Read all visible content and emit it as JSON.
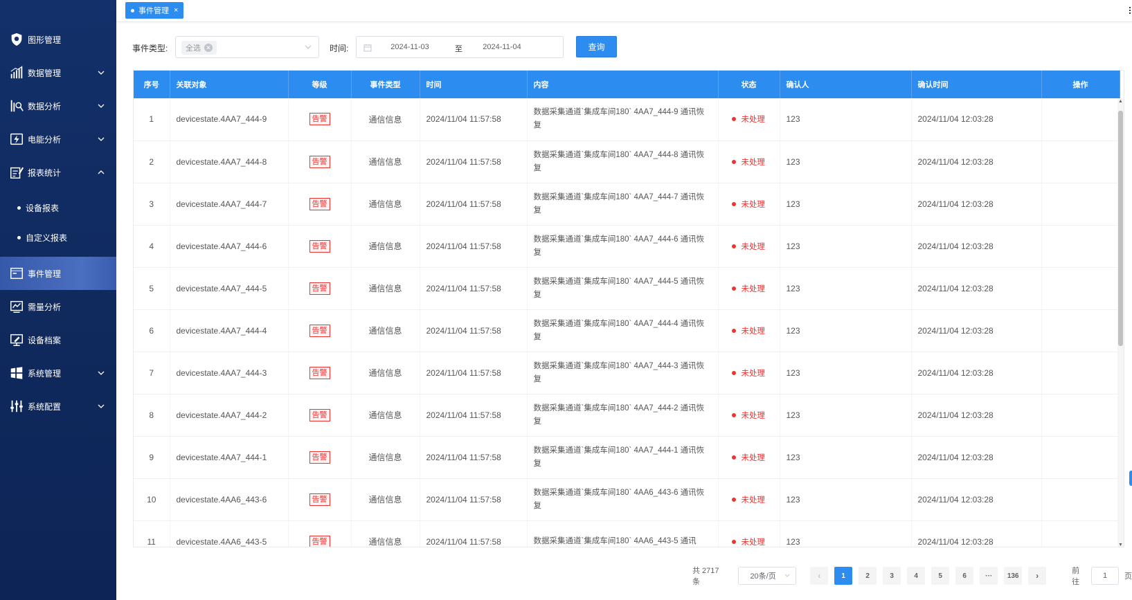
{
  "sidebar": {
    "items": [
      {
        "label": "图形管理",
        "icon": "shield-icon",
        "chevron": ""
      },
      {
        "label": "数据管理",
        "icon": "bar-chart-icon",
        "chevron": "down"
      },
      {
        "label": "数据分析",
        "icon": "analysis-icon",
        "chevron": "down"
      },
      {
        "label": "电能分析",
        "icon": "energy-icon",
        "chevron": "down"
      },
      {
        "label": "报表统计",
        "icon": "report-icon",
        "chevron": "up"
      }
    ],
    "subitems": [
      {
        "label": "设备报表"
      },
      {
        "label": "自定义报表"
      }
    ],
    "items2": [
      {
        "label": "事件管理",
        "icon": "event-icon",
        "chevron": "",
        "active": true
      },
      {
        "label": "需量分析",
        "icon": "demand-chart-icon",
        "chevron": ""
      },
      {
        "label": "设备档案",
        "icon": "device-file-icon",
        "chevron": ""
      },
      {
        "label": "系统管理",
        "icon": "windows-icon",
        "chevron": "down"
      },
      {
        "label": "系统配置",
        "icon": "sliders-icon",
        "chevron": "down"
      }
    ]
  },
  "tabs": [
    {
      "label": "事件管理",
      "close": "×"
    }
  ],
  "filters": {
    "event_type_label": "事件类型:",
    "event_type_value": "全选",
    "time_label": "时间:",
    "date_start": "2024-11-03",
    "date_sep": "至",
    "date_end": "2024-11-04",
    "query_button": "查询"
  },
  "table": {
    "headers": [
      "序号",
      "关联对象",
      "等级",
      "事件类型",
      "时间",
      "内容",
      "状态",
      "确认人",
      "确认时间",
      "操作"
    ],
    "rows": [
      {
        "no": "1",
        "object": "devicestate.4AA7_444-9",
        "level": "告警",
        "type": "通信信息",
        "time": "2024/11/04 11:57:58",
        "content": "数据采集通道`集成车间180` 4AA7_444-9 通讯恢复",
        "status": "未处理",
        "confirmer": "123",
        "confirm_time": "2024/11/04 12:03:28"
      },
      {
        "no": "2",
        "object": "devicestate.4AA7_444-8",
        "level": "告警",
        "type": "通信信息",
        "time": "2024/11/04 11:57:58",
        "content": "数据采集通道`集成车间180` 4AA7_444-8 通讯恢复",
        "status": "未处理",
        "confirmer": "123",
        "confirm_time": "2024/11/04 12:03:28"
      },
      {
        "no": "3",
        "object": "devicestate.4AA7_444-7",
        "level": "告警",
        "type": "通信信息",
        "time": "2024/11/04 11:57:58",
        "content": "数据采集通道`集成车间180` 4AA7_444-7 通讯恢复",
        "status": "未处理",
        "confirmer": "123",
        "confirm_time": "2024/11/04 12:03:28"
      },
      {
        "no": "4",
        "object": "devicestate.4AA7_444-6",
        "level": "告警",
        "type": "通信信息",
        "time": "2024/11/04 11:57:58",
        "content": "数据采集通道`集成车间180` 4AA7_444-6 通讯恢复",
        "status": "未处理",
        "confirmer": "123",
        "confirm_time": "2024/11/04 12:03:28"
      },
      {
        "no": "5",
        "object": "devicestate.4AA7_444-5",
        "level": "告警",
        "type": "通信信息",
        "time": "2024/11/04 11:57:58",
        "content": "数据采集通道`集成车间180` 4AA7_444-5 通讯恢复",
        "status": "未处理",
        "confirmer": "123",
        "confirm_time": "2024/11/04 12:03:28"
      },
      {
        "no": "6",
        "object": "devicestate.4AA7_444-4",
        "level": "告警",
        "type": "通信信息",
        "time": "2024/11/04 11:57:58",
        "content": "数据采集通道`集成车间180` 4AA7_444-4 通讯恢复",
        "status": "未处理",
        "confirmer": "123",
        "confirm_time": "2024/11/04 12:03:28"
      },
      {
        "no": "7",
        "object": "devicestate.4AA7_444-3",
        "level": "告警",
        "type": "通信信息",
        "time": "2024/11/04 11:57:58",
        "content": "数据采集通道`集成车间180` 4AA7_444-3 通讯恢复",
        "status": "未处理",
        "confirmer": "123",
        "confirm_time": "2024/11/04 12:03:28"
      },
      {
        "no": "8",
        "object": "devicestate.4AA7_444-2",
        "level": "告警",
        "type": "通信信息",
        "time": "2024/11/04 11:57:58",
        "content": "数据采集通道`集成车间180` 4AA7_444-2 通讯恢复",
        "status": "未处理",
        "confirmer": "123",
        "confirm_time": "2024/11/04 12:03:28"
      },
      {
        "no": "9",
        "object": "devicestate.4AA7_444-1",
        "level": "告警",
        "type": "通信信息",
        "time": "2024/11/04 11:57:58",
        "content": "数据采集通道`集成车间180` 4AA7_444-1 通讯恢复",
        "status": "未处理",
        "confirmer": "123",
        "confirm_time": "2024/11/04 12:03:28"
      },
      {
        "no": "10",
        "object": "devicestate.4AA6_443-6",
        "level": "告警",
        "type": "通信信息",
        "time": "2024/11/04 11:57:58",
        "content": "数据采集通道`集成车间180` 4AA6_443-6 通讯恢复",
        "status": "未处理",
        "confirmer": "123",
        "confirm_time": "2024/11/04 12:03:28"
      },
      {
        "no": "11",
        "object": "devicestate.4AA6_443-5",
        "level": "告警",
        "type": "通信信息",
        "time": "2024/11/04 11:57:58",
        "content": "数据采集通道`集成车间180` 4AA6_443-5 通讯",
        "status": "未处理",
        "confirmer": "123",
        "confirm_time": "2024/11/04 12:03:28"
      }
    ]
  },
  "pagination": {
    "total": "共 2717 条",
    "page_size": "20条/页",
    "pages": [
      "1",
      "2",
      "3",
      "4",
      "5",
      "6",
      "···",
      "136"
    ],
    "current": "1",
    "goto_label": "前往",
    "goto_value": "1",
    "page_unit": "页"
  },
  "colors": {
    "primary": "#2d8cf0",
    "sidebar_bg": "#13306a",
    "alert": "#ee3333"
  }
}
